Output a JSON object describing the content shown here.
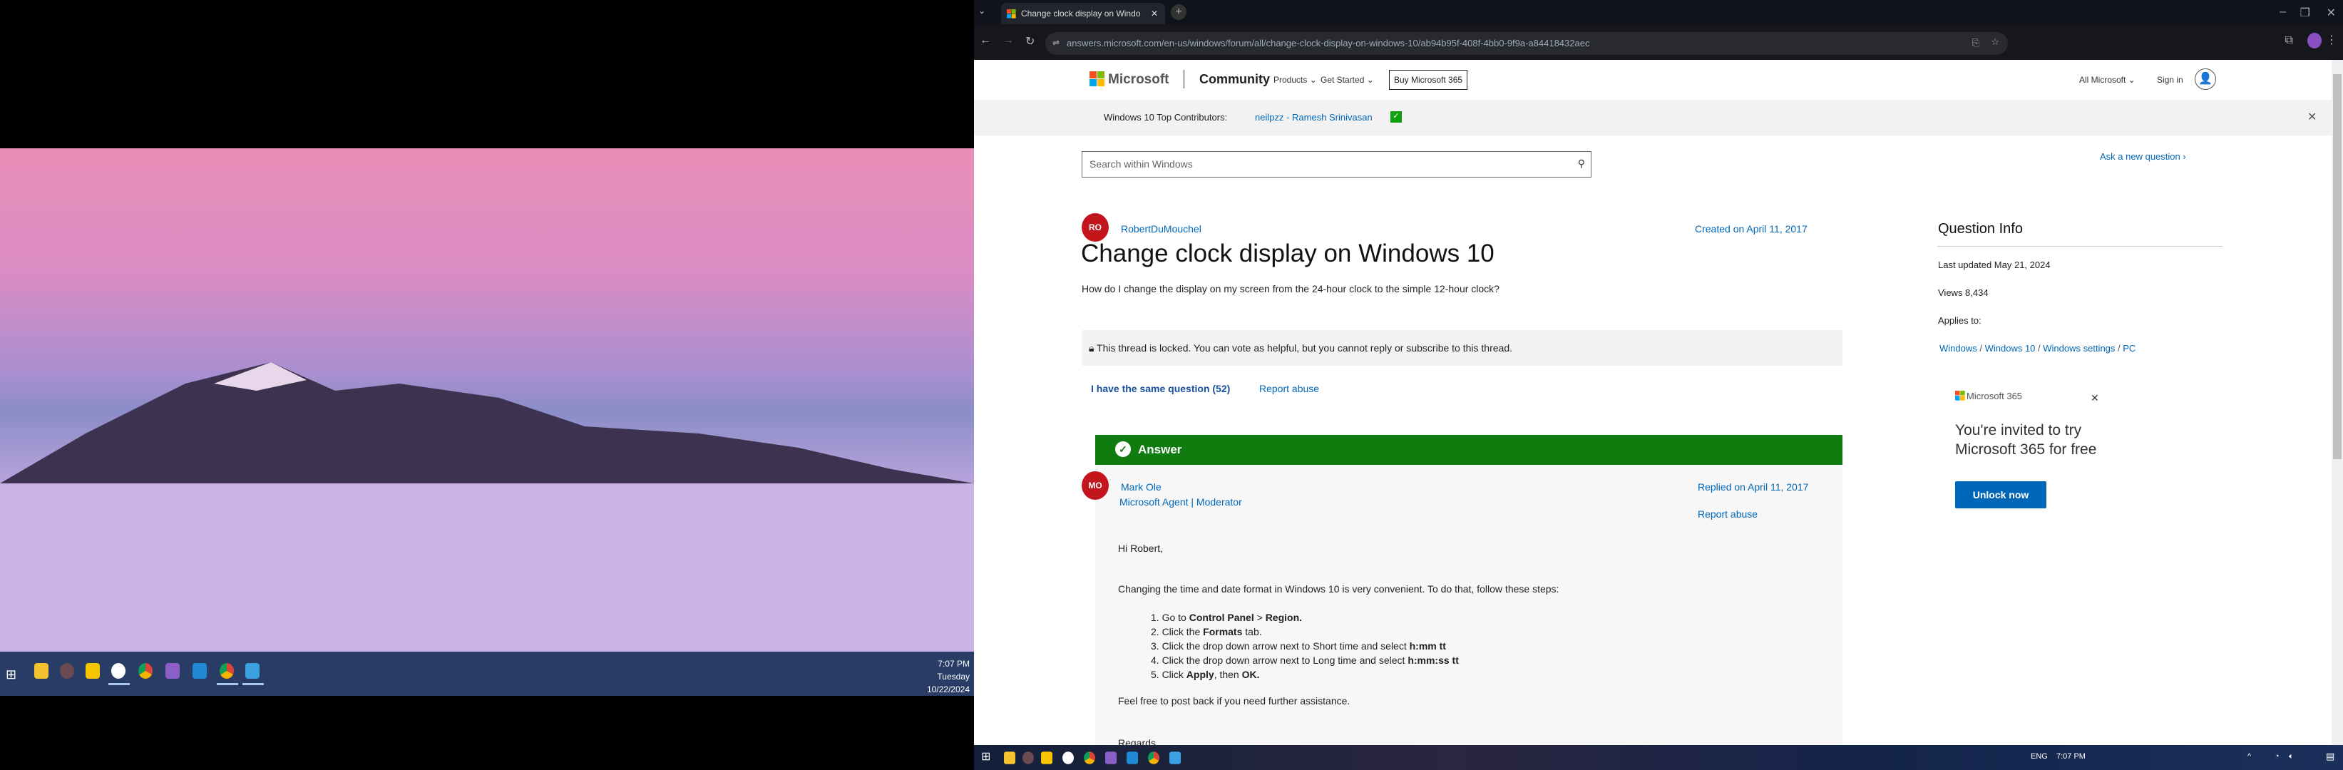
{
  "left_screen": {
    "clock": {
      "time": "7:07 PM",
      "day": "Tuesday",
      "date": "10/22/2024"
    }
  },
  "browser": {
    "tab_title": "Change clock display on Windo",
    "url": "answers.microsoft.com/en-us/windows/forum/all/change-clock-display-on-windows-10/ab94b95f-408f-4bb0-9f9a-a84418432aec"
  },
  "header": {
    "brand": "Microsoft",
    "community": "Community",
    "nav": [
      "Products",
      "Get Started"
    ],
    "buy_button": "Buy Microsoft 365",
    "all_microsoft": "All Microsoft",
    "sign_in": "Sign in"
  },
  "contributors": {
    "label": "Windows 10 Top Contributors:",
    "names": "neilpzz - Ramesh Srinivasan"
  },
  "search": {
    "placeholder": "Search within Windows"
  },
  "ask_new": "Ask a new question",
  "question": {
    "avatar": "RO",
    "author": "RobertDuMouchel",
    "created": "Created on April 11, 2017",
    "title": "Change clock display on Windows 10",
    "body": "How do I change the display on my screen from the 24-hour clock to the simple 12-hour clock?",
    "locked_notice": "This thread is locked. You can vote as helpful, but you cannot reply or subscribe to this thread.",
    "same_question": "I have the same question (52)",
    "report": "Report abuse"
  },
  "answer": {
    "label": "Answer",
    "avatar": "MO",
    "author": "Mark Ole",
    "role1": "Microsoft Agent",
    "role2": "Moderator",
    "replied": "Replied on April 11, 2017",
    "report": "Report abuse",
    "greeting": "Hi Robert,",
    "intro": "Changing the time and date format in Windows 10 is very convenient. To do that, follow these steps:",
    "steps": [
      {
        "pre": "1. Go to ",
        "b1": "Control Panel",
        "mid": " > ",
        "b2": "Region.",
        "post": ""
      },
      {
        "pre": "2. Click the ",
        "b1": "Formats",
        "mid": " tab.",
        "b2": "",
        "post": ""
      },
      {
        "pre": "3. Click the drop down arrow next to Short time and select ",
        "b1": "h:mm tt",
        "mid": "",
        "b2": "",
        "post": ""
      },
      {
        "pre": "4. Click the drop down arrow next to Long time and select ",
        "b1": "h:mm:ss tt",
        "mid": "",
        "b2": "",
        "post": ""
      },
      {
        "pre": "5. Click ",
        "b1": "Apply",
        "mid": ", then ",
        "b2": "OK.",
        "post": ""
      }
    ],
    "closing": "Feel free to post back if you need further assistance.",
    "regards": "Regards,"
  },
  "info": {
    "title": "Question Info",
    "last_updated": "Last updated May 21, 2024",
    "views": "Views 8,434",
    "applies": "Applies to:",
    "links": [
      "Windows",
      "Windows 10",
      "Windows settings",
      "PC"
    ]
  },
  "ad": {
    "brand": "Microsoft 365",
    "line1": "You're invited to try",
    "line2": "Microsoft 365 for free",
    "button": "Unlock now"
  },
  "right_taskbar": {
    "lang": "ENG",
    "time": "7:07 PM"
  },
  "colors": {
    "accent": "#0067b8",
    "answer_green": "#107c10",
    "avatar_red": "#c3161c"
  }
}
